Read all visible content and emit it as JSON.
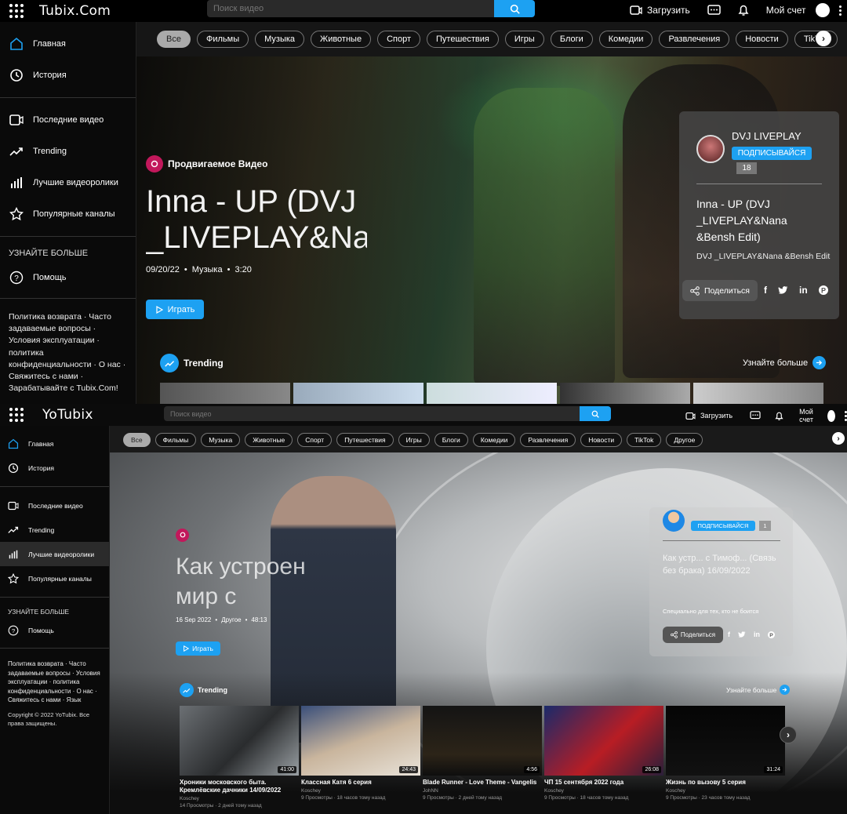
{
  "shot1": {
    "logo": "Tubix.Com",
    "search_placeholder": "Поиск видео",
    "upload_label": "Загрузить",
    "account_label": "Мой счет",
    "sidebar": {
      "items": [
        {
          "label": "Главная",
          "icon": "home-icon"
        },
        {
          "label": "История",
          "icon": "history-icon"
        },
        {
          "label": "Последние видео",
          "icon": "video-icon"
        },
        {
          "label": "Trending",
          "icon": "trending-icon"
        },
        {
          "label": "Лучшие видеоролики",
          "icon": "bar-chart-icon"
        },
        {
          "label": "Популярные каналы",
          "icon": "star-icon"
        }
      ],
      "more_heading": "УЗНАЙТЕ БОЛЬШЕ",
      "help_label": "Помощь",
      "footer": "Политика возврата · Часто задаваемые вопросы · Условия эксплуатации · политика конфиденциальности · О нас · Свяжитесь с нами · Зарабатывайте с Tubix.Com!"
    },
    "chips": [
      "Все",
      "Фильмы",
      "Музыка",
      "Животные",
      "Спорт",
      "Путешествия",
      "Игры",
      "Блоги",
      "Комедии",
      "Развлечения",
      "Новости",
      "TikTok"
    ],
    "hero": {
      "badge": "Продвигаемое Видео",
      "title": "Inna - UP (DVJ _LIVEPLAY&Na",
      "date": "09/20/22",
      "category": "Музыка",
      "duration": "3:20",
      "play_label": "Играть"
    },
    "card": {
      "channel": "DVJ LIVEPLAY",
      "subscribe_label": "ПОДПИСЫВАЙСЯ",
      "subscribers": "18",
      "title": "Inna - UP (DVJ _LIVEPLAY&Nana &Bensh Edit)",
      "description": "DVJ _LIVEPLAY&Nana &Bensh Edit",
      "share_label": "Поделиться"
    },
    "trending_label": "Trending",
    "more_label": "Узнайте больше"
  },
  "shot2": {
    "logo": "YoTubix",
    "search_placeholder": "Поиск видео",
    "upload_label": "Загрузить",
    "account_label": "Мой счет",
    "sidebar": {
      "items": [
        {
          "label": "Главная",
          "icon": "home-icon"
        },
        {
          "label": "История",
          "icon": "history-icon"
        },
        {
          "label": "Последние видео",
          "icon": "video-icon"
        },
        {
          "label": "Trending",
          "icon": "trending-icon"
        },
        {
          "label": "Лучшие видеоролики",
          "icon": "bar-chart-icon"
        },
        {
          "label": "Популярные каналы",
          "icon": "star-icon"
        }
      ],
      "more_heading": "УЗНАЙТЕ БОЛЬШЕ",
      "help_label": "Помощь",
      "footer": "Политика возврата · Часто задаваемые вопросы · Условия эксплуатации · политика конфиденциальности · О нас · Свяжитесь с нами · Язык",
      "copyright": "Copyright © 2022 YoTubix. Все права защищены."
    },
    "chips": [
      "Все",
      "Фильмы",
      "Музыка",
      "Животные",
      "Спорт",
      "Путешествия",
      "Игры",
      "Блоги",
      "Комедии",
      "Развлечения",
      "Новости",
      "TikTok",
      "Другое"
    ],
    "hero": {
      "title": "Как устроен мир с",
      "date": "16 Sep 2022",
      "category": "Другое",
      "duration": "48:13",
      "play_label": "Играть"
    },
    "card": {
      "subscribe_label": "ПОДПИСЫВАЙСЯ",
      "subscribers": "1",
      "title": "Как устр... с Тимоф... (Связь без брака) 16/09/2022",
      "description": "Специально для тех, кто не боится",
      "share_label": "Поделиться"
    },
    "trending_label": "Trending",
    "more_label": "Узнайте больше",
    "videos": [
      {
        "title": "Хроники московского быта. Кремлёвские дачники 14/09/2022",
        "channel": "Koschey",
        "meta": "14 Просмотры · 2 дней тому назад",
        "duration": "41:00"
      },
      {
        "title": "Классная Катя 6 серия",
        "channel": "Koschey",
        "meta": "9 Просмотры · 18 часов тому назад",
        "duration": "24:43"
      },
      {
        "title": "Blade Runner - Love Theme - Vangelis",
        "channel": "JohNN",
        "meta": "9 Просмотры · 2 дней тому назад",
        "duration": "4:56"
      },
      {
        "title": "ЧП 15 сентября 2022 года",
        "channel": "Koschey",
        "meta": "9 Просмотры · 18 часов тому назад",
        "duration": "26:08"
      },
      {
        "title": "Жизнь по вызову 5 серия",
        "channel": "Koschey",
        "meta": "9 Просмотры · 23 часов тому назад",
        "duration": "31:24"
      }
    ]
  }
}
